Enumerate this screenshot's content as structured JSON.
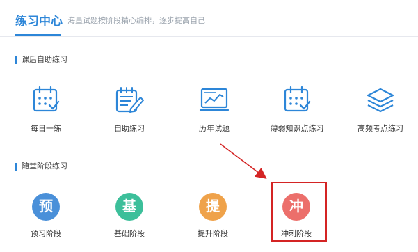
{
  "header": {
    "title": "练习中心",
    "subtitle": "海量试题按阶段精心编排，逐步提高自己"
  },
  "sections": [
    {
      "title": "课后自助练习",
      "items": [
        {
          "label": "每日一练",
          "icon": "calendar-check-icon"
        },
        {
          "label": "自助练习",
          "icon": "notepad-pencil-icon"
        },
        {
          "label": "历年试题",
          "icon": "monitor-chart-icon"
        },
        {
          "label": "薄弱知识点练习",
          "icon": "calendar-check-icon"
        },
        {
          "label": "高频考点练习",
          "icon": "layers-icon"
        }
      ]
    },
    {
      "title": "随堂阶段练习",
      "items": [
        {
          "label": "预习阶段",
          "glyph": "预",
          "color": "#4a90d9"
        },
        {
          "label": "基础阶段",
          "glyph": "基",
          "color": "#3cbf9a"
        },
        {
          "label": "提升阶段",
          "glyph": "提",
          "color": "#efa24a"
        },
        {
          "label": "冲刺阶段",
          "glyph": "冲",
          "color": "#ec6f6b"
        }
      ]
    }
  ],
  "colors": {
    "accent": "#2d86d8",
    "highlight": "#d42424"
  }
}
